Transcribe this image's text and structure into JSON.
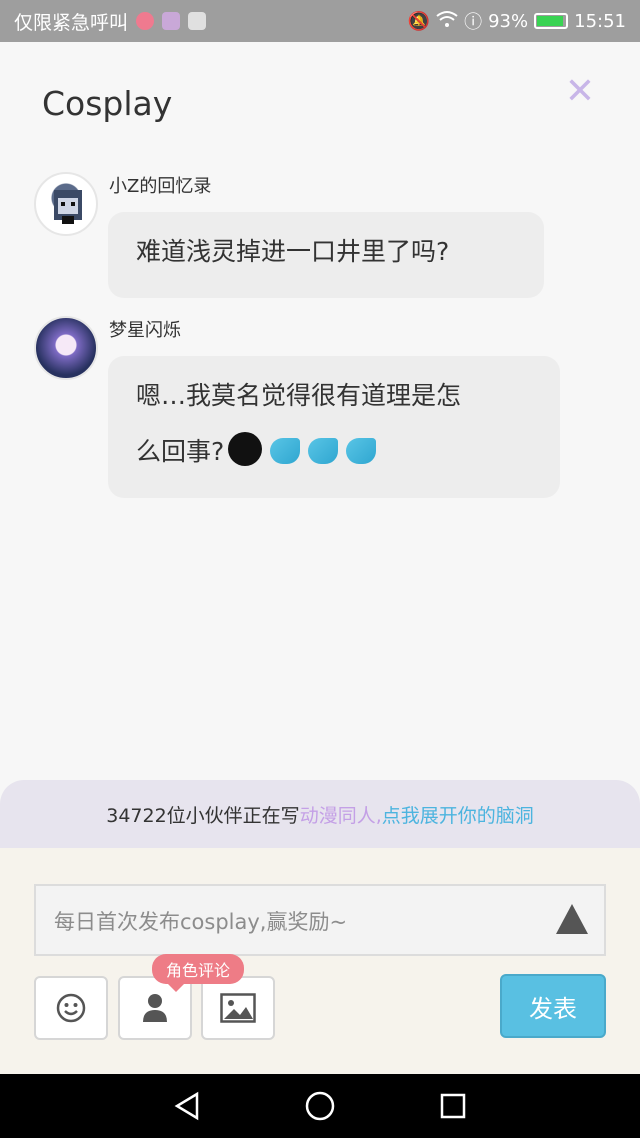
{
  "status_bar": {
    "carrier": "仅限紧急呼叫",
    "battery_pct": "93%",
    "time": "15:51"
  },
  "header": {
    "title": "Cosplay",
    "close_icon": "close-icon"
  },
  "messages": [
    {
      "username": "小Z的回忆录",
      "text": "难道浅灵掉进一口井里了吗?"
    },
    {
      "username": "梦星闪烁",
      "text_line1": "嗯…我莫名觉得很有道理是怎",
      "text_line2": "么回事?"
    }
  ],
  "promo": {
    "prefix": "34722位小伙伴正在写",
    "highlight1": "动漫同人,",
    "highlight2": "点我展开你的脑洞"
  },
  "composer": {
    "placeholder": "每日首次发布cosplay,赢奖励~",
    "role_tag": "角色评论",
    "publish_label": "发表"
  },
  "colors": {
    "accent_purple": "#c4a0e6",
    "accent_blue": "#4cb4df",
    "publish_bg": "#59c0e2",
    "tag_pink": "#ee7c86"
  }
}
